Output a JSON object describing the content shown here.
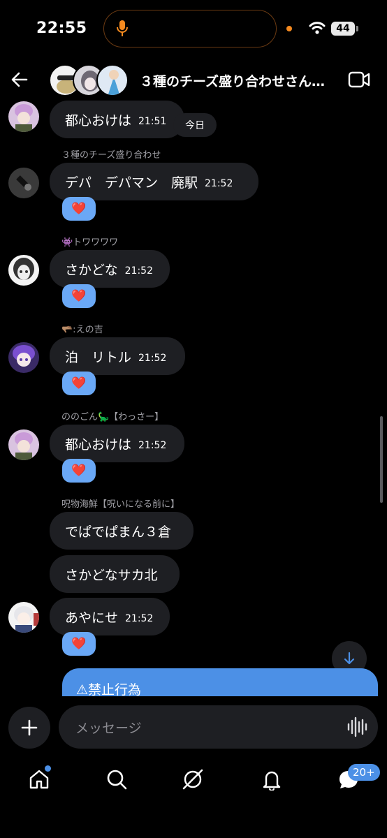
{
  "status_bar": {
    "time": "22:55",
    "battery": "44"
  },
  "header": {
    "title": "３種のチーズ盛り合わせさん…"
  },
  "today_label": "今日",
  "messages": [
    {
      "text": "都心おけは",
      "time": "21:51"
    },
    {
      "sender": "３種のチーズ盛り合わせ",
      "text": "デパ　デパマン　廃駅",
      "time": "21:52",
      "reaction": "❤️"
    },
    {
      "sender": "👾トワワワワ",
      "text": "さかどな",
      "time": "21:52",
      "reaction": "❤️"
    },
    {
      "sender": "🫳🏽:えの吉",
      "text": "泊　リトル",
      "time": "21:52",
      "reaction": "❤️"
    },
    {
      "sender": "ののごん🦕【わっさー】",
      "text": "都心おけは",
      "time": "21:52",
      "reaction": "❤️"
    },
    {
      "sender": "呪物海鮮【呪いになる前に】",
      "text": "でぱでぱまん３倉"
    },
    {
      "text": "さかどなサカ北"
    },
    {
      "text": "あやにせ",
      "time": "21:52",
      "reaction": "❤️"
    }
  ],
  "warning_banner": "⚠禁止行為",
  "composer": {
    "placeholder": "メッセージ"
  },
  "nav": {
    "messages_badge": "20+"
  },
  "colors": {
    "accent": "#4c90e6",
    "heart_bg": "#6aa8f6",
    "bubble": "#1e1f23"
  },
  "icons": [
    "back-arrow-icon",
    "video-call-icon",
    "microphone-icon",
    "wifi-icon",
    "plus-icon",
    "voice-wave-icon",
    "home-icon",
    "search-icon",
    "grok-icon",
    "bell-icon",
    "messages-icon",
    "arrow-down-icon"
  ]
}
